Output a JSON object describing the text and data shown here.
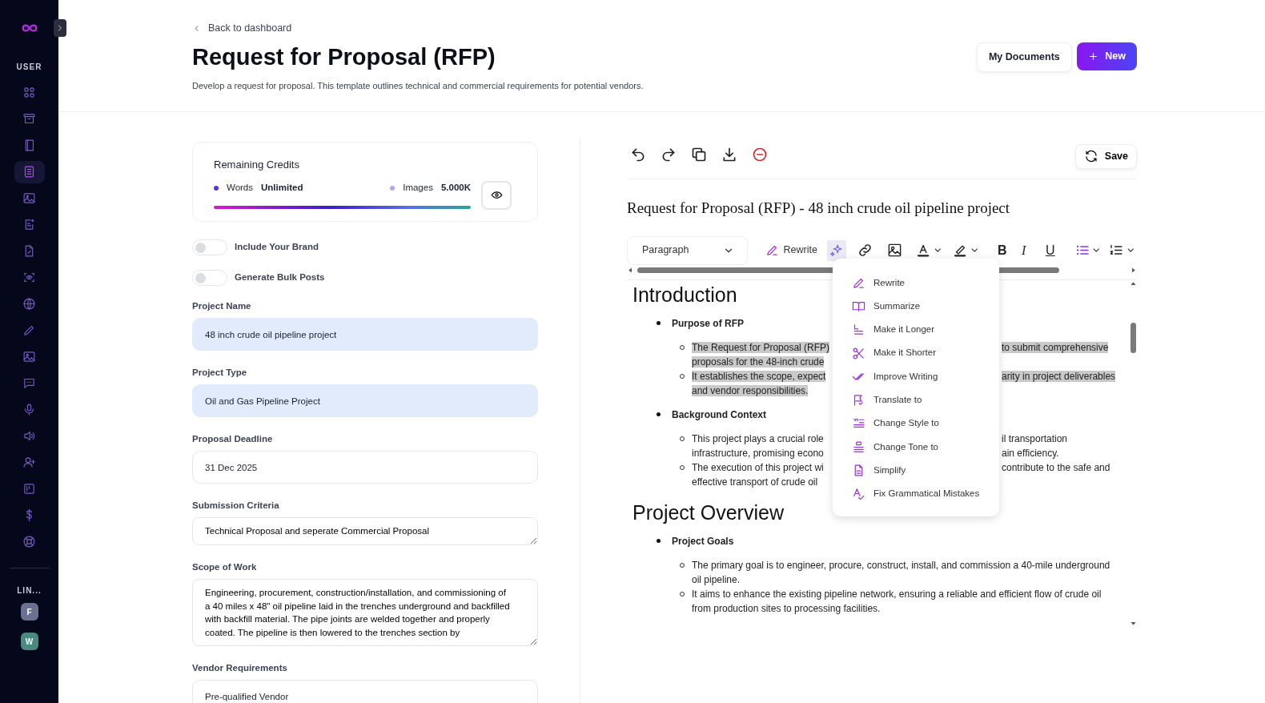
{
  "sidebar": {
    "section_label": "USER",
    "items": [
      {
        "selected": false
      },
      {
        "selected": false
      },
      {
        "selected": false
      },
      {
        "selected": true
      },
      {
        "selected": false
      },
      {
        "selected": false
      },
      {
        "selected": false
      },
      {
        "selected": false
      },
      {
        "selected": false
      },
      {
        "selected": false
      },
      {
        "selected": false
      },
      {
        "selected": false
      },
      {
        "selected": false
      },
      {
        "selected": false
      },
      {
        "selected": false
      },
      {
        "selected": false
      },
      {
        "selected": false
      },
      {
        "selected": false
      }
    ],
    "links_label": "LIN...",
    "links": [
      {
        "letter": "F",
        "color": "#6b7191"
      },
      {
        "letter": "W",
        "color": "#4a8a80"
      }
    ]
  },
  "header": {
    "back_link": "Back to dashboard",
    "title": "Request for Proposal (RFP)",
    "description": "Develop a request for proposal. This template outlines technical and commercial requirements for potential vendors.",
    "buttons": [
      {
        "label": "My Documents",
        "kind": "secondary"
      },
      {
        "label": "New",
        "kind": "primary"
      }
    ]
  },
  "credits": {
    "title": "Remaining Credits",
    "legend": [
      {
        "label": "Words",
        "value": "Unlimited",
        "color": "#4b3bd9"
      },
      {
        "label": "Images",
        "value": "5.000K",
        "color": "#b9a3f0"
      }
    ],
    "level": 1
  },
  "toggles": [
    {
      "label": "Include Your Brand",
      "on": false
    },
    {
      "label": "Generate Bulk Posts",
      "on": false
    }
  ],
  "fields": [
    {
      "label": "Project Name",
      "value": "48 inch crude oil pipeline project",
      "kind": "input",
      "autofilled": true
    },
    {
      "label": "Project Type",
      "value": "Oil and Gas Pipeline Project",
      "kind": "input",
      "autofilled": true
    },
    {
      "label": "Proposal Deadline",
      "value": "31 Dec 2025",
      "kind": "input",
      "autofilled": false
    },
    {
      "label": "Submission Criteria",
      "value": "Technical Proposal and seperate Commercial Proposal",
      "kind": "textarea",
      "autofilled": false
    },
    {
      "label": "Scope of Work",
      "value": "Engineering, procurement, construction/installation, and commissioning of a 40 miles x 48\" oil pipeline laid in the trenches underground and backfilled with backfill material. The pipe joints are welded together and properly coated. The pipeline is then lowered to the trenches section by",
      "kind": "scroll-textarea",
      "autofilled": false
    },
    {
      "label": "Vendor Requirements",
      "value": "Pre-qualified Vendor",
      "kind": "input",
      "autofilled": false
    }
  ],
  "editor": {
    "save_label": "Save",
    "doc_title": "Request for Proposal (RFP) - 48 inch crude oil pipeline project",
    "block_format": "Paragraph",
    "rewrite_label": "Rewrite",
    "ai_active": true,
    "format_buttons": [
      "B",
      "I",
      "U"
    ],
    "sections": [
      {
        "heading": "Introduction",
        "items": [
          {
            "label": "Purpose of RFP",
            "points": [
              {
                "kind": "covered",
                "highlighted": true,
                "lines": [
                  {
                    "left": "The Request for Proposal (RFP)",
                    "right": "to submit comprehensive"
                  },
                  {
                    "left": "proposals for the 48-inch crude"
                  }
                ]
              },
              {
                "kind": "covered",
                "highlighted": true,
                "lines": [
                  {
                    "left": "It establishes the scope, expect",
                    "right": "arity in project deliverables"
                  },
                  {
                    "left": "and vendor responsibilities."
                  }
                ]
              }
            ]
          },
          {
            "label": "Background Context",
            "points": [
              {
                "kind": "covered",
                "highlighted": false,
                "lines": [
                  {
                    "left": "This project plays a crucial role",
                    "right": "il transportation"
                  },
                  {
                    "left": "infrastructure, promising econo",
                    "right": "ain efficiency."
                  }
                ]
              },
              {
                "kind": "covered",
                "highlighted": false,
                "lines": [
                  {
                    "left": "The execution of this project wi",
                    "right": "contribute to the safe and"
                  },
                  {
                    "left": "effective transport of crude oil"
                  }
                ]
              }
            ]
          }
        ]
      },
      {
        "heading": "Project Overview",
        "items": [
          {
            "label": "Project Goals",
            "points": [
              {
                "kind": "full",
                "highlighted": false,
                "text": "The primary goal is to engineer, procure, construct, install, and commission a 40-mile underground oil pipeline."
              },
              {
                "kind": "full",
                "highlighted": false,
                "text": "It aims to enhance the existing pipeline network, ensuring a reliable and efficient flow of crude oil from production sites to processing facilities."
              }
            ]
          }
        ]
      }
    ],
    "menu": [
      "Rewrite",
      "Summarize",
      "Make it Longer",
      "Make it Shorter",
      "Improve Writing",
      "Translate to",
      "Change Style to",
      "Change Tone to",
      "Simplify",
      "Fix Grammatical Mistakes"
    ]
  }
}
